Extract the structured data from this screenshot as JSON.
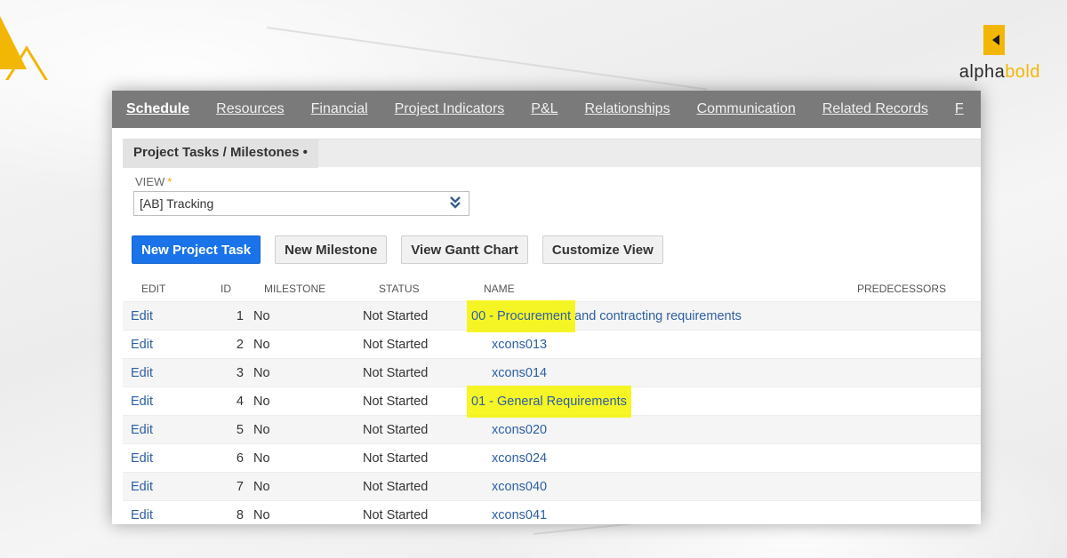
{
  "brand": {
    "alpha": "alpha",
    "bold": "bold",
    "accent_color": "#f2b705",
    "icon": "alphabold-logo-icon"
  },
  "tabs": [
    {
      "label": "Schedule",
      "active": true
    },
    {
      "label": "Resources"
    },
    {
      "label": "Financial"
    },
    {
      "label": "Project Indicators"
    },
    {
      "label": "P&L"
    },
    {
      "label": "Relationships"
    },
    {
      "label": "Communication"
    },
    {
      "label": "Related Records"
    },
    {
      "label": "F"
    }
  ],
  "section": {
    "title": "Project Tasks / Milestones •"
  },
  "view": {
    "label": "VIEW",
    "required_mark": "*",
    "value": "[AB] Tracking",
    "icon": "double-chevron-down-icon"
  },
  "buttons": {
    "new_task": "New Project Task",
    "new_milestone": "New Milestone",
    "gantt": "View Gantt Chart",
    "customize": "Customize View",
    "primary_color": "#1a73e8"
  },
  "table": {
    "headers": {
      "edit": "EDIT",
      "id": "ID",
      "milestone": "MILESTONE",
      "status": "STATUS",
      "name": "NAME",
      "predecessors": "PREDECESSORS"
    },
    "rows": [
      {
        "edit": "Edit",
        "id": "1",
        "milestone": "No",
        "status": "Not Started",
        "name": "00 - Procurement and contracting requirements",
        "highlight": "00 - Procurement",
        "rest": " and contracting requirements",
        "indent": false
      },
      {
        "edit": "Edit",
        "id": "2",
        "milestone": "No",
        "status": "Not Started",
        "name": "xcons013",
        "indent": true
      },
      {
        "edit": "Edit",
        "id": "3",
        "milestone": "No",
        "status": "Not Started",
        "name": "xcons014",
        "indent": true
      },
      {
        "edit": "Edit",
        "id": "4",
        "milestone": "No",
        "status": "Not Started",
        "name": "01 - General Requirements",
        "highlight": "01 - General Requirements",
        "rest": "",
        "indent": false
      },
      {
        "edit": "Edit",
        "id": "5",
        "milestone": "No",
        "status": "Not Started",
        "name": "xcons020",
        "indent": true
      },
      {
        "edit": "Edit",
        "id": "6",
        "milestone": "No",
        "status": "Not Started",
        "name": "xcons024",
        "indent": true
      },
      {
        "edit": "Edit",
        "id": "7",
        "milestone": "No",
        "status": "Not Started",
        "name": "xcons040",
        "indent": true
      },
      {
        "edit": "Edit",
        "id": "8",
        "milestone": "No",
        "status": "Not Started",
        "name": "xcons041",
        "indent": true
      }
    ],
    "highlight_color": "#f4f400"
  }
}
